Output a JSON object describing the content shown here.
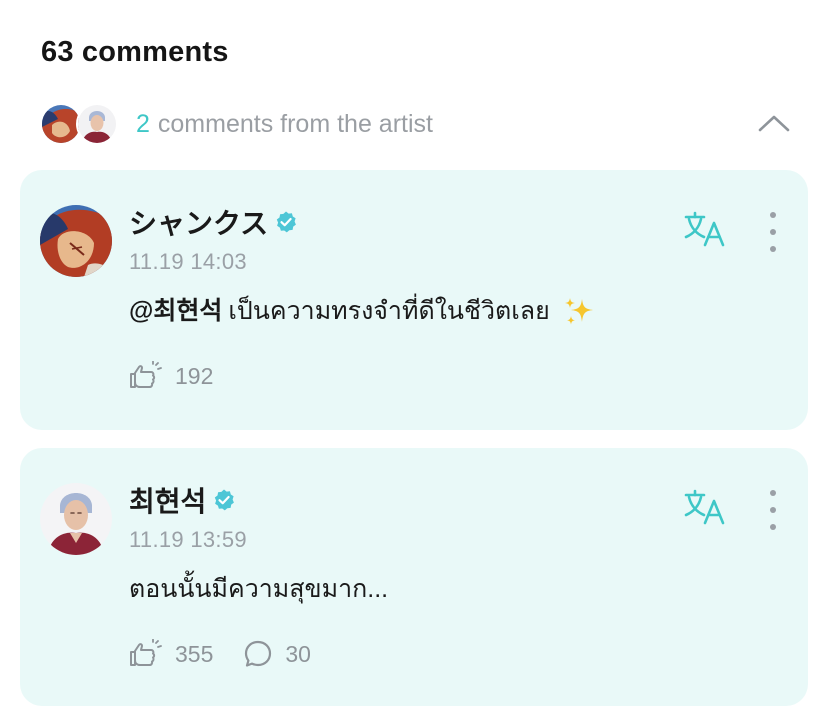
{
  "header": {
    "title": "63 comments"
  },
  "artist_summary": {
    "count": "2",
    "label": "comments from the artist",
    "collapse_icon": "chevron-up-icon"
  },
  "colors": {
    "accent": "#3ec7c7",
    "card_background": "#e9f9f8",
    "verified": "#4dc6d6",
    "muted_text": "#9aa0a6"
  },
  "comments": [
    {
      "author": "シャンクス",
      "verified": true,
      "timestamp": "11.19 14:03",
      "mention": "@최현석",
      "text": "เป็นความทรงจำที่ดีในชีวิตเลย",
      "emoji": "sparkles",
      "likes": "192",
      "translate_icon": "translate-icon",
      "more_icon": "more-vertical-icon"
    },
    {
      "author": "최현석",
      "verified": true,
      "timestamp": "11.19 13:59",
      "text": "ตอนนั้นมีความสุขมาก...",
      "likes": "355",
      "replies": "30",
      "translate_icon": "translate-icon",
      "more_icon": "more-vertical-icon"
    }
  ]
}
